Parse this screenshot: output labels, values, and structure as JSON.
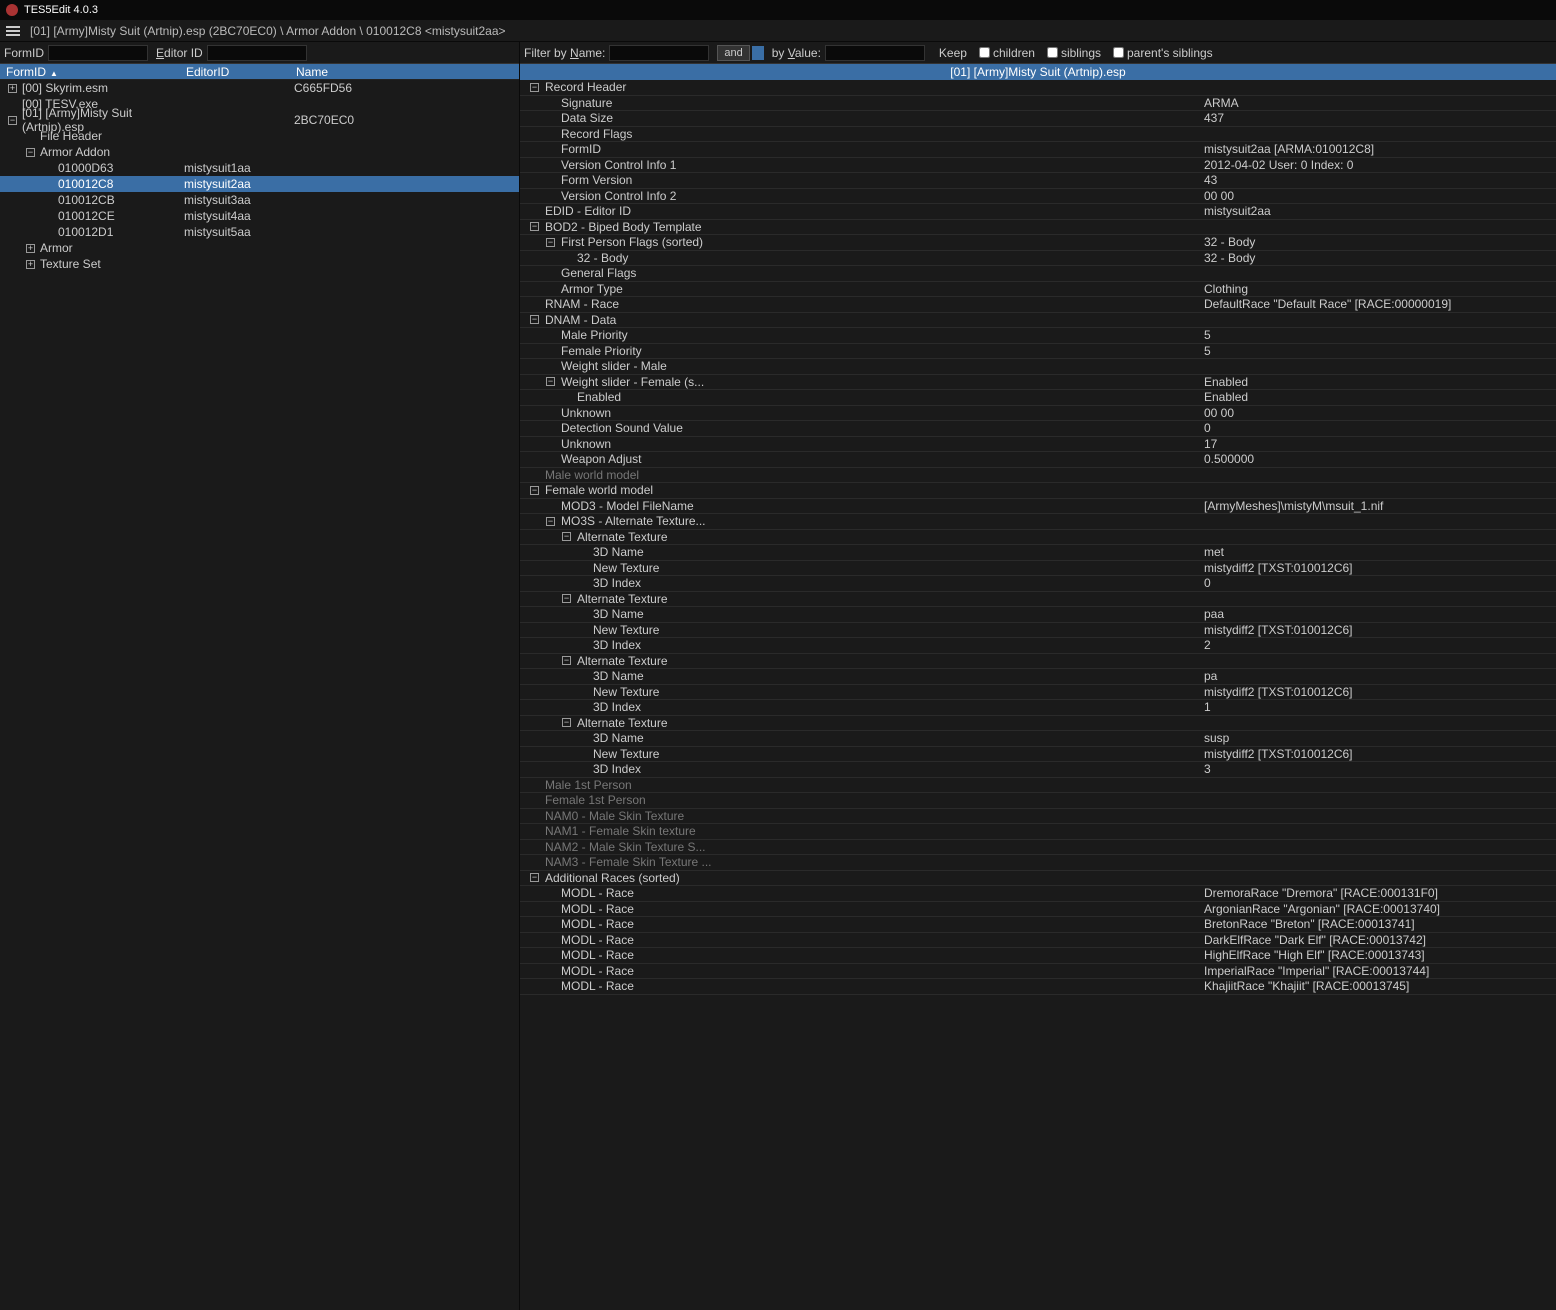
{
  "title": "TES5Edit 4.0.3",
  "breadcrumb": "[01] [Army]Misty Suit (Artnip).esp (2BC70EC0) \\ Armor Addon \\ 010012C8 <mistysuit2aa>",
  "leftFilter": {
    "formId": "FormID",
    "editorId": "Editor ID"
  },
  "leftCols": {
    "id": "FormID",
    "eid": "EditorID",
    "name": "Name"
  },
  "leftTree": [
    {
      "indent": 0,
      "tog": "+",
      "id": "[00] Skyrim.esm",
      "eid": "",
      "name": "C665FD56"
    },
    {
      "indent": 0,
      "tog": "",
      "id": "[00] TESV.exe",
      "eid": "",
      "name": ""
    },
    {
      "indent": 0,
      "tog": "-",
      "id": "[01] [Army]Misty Suit (Artnip).esp",
      "eid": "",
      "name": "2BC70EC0"
    },
    {
      "indent": 1,
      "tog": "",
      "id": "File Header",
      "eid": "",
      "name": ""
    },
    {
      "indent": 1,
      "tog": "-",
      "id": "Armor Addon",
      "eid": "",
      "name": ""
    },
    {
      "indent": 2,
      "tog": "",
      "id": "01000D63",
      "eid": "mistysuit1aa",
      "name": ""
    },
    {
      "indent": 2,
      "tog": "",
      "id": "010012C8",
      "eid": "mistysuit2aa",
      "name": "",
      "sel": true
    },
    {
      "indent": 2,
      "tog": "",
      "id": "010012CB",
      "eid": "mistysuit3aa",
      "name": ""
    },
    {
      "indent": 2,
      "tog": "",
      "id": "010012CE",
      "eid": "mistysuit4aa",
      "name": ""
    },
    {
      "indent": 2,
      "tog": "",
      "id": "010012D1",
      "eid": "mistysuit5aa",
      "name": ""
    },
    {
      "indent": 1,
      "tog": "+",
      "id": "Armor",
      "eid": "",
      "name": ""
    },
    {
      "indent": 1,
      "tog": "+",
      "id": "Texture Set",
      "eid": "",
      "name": ""
    }
  ],
  "rightFilter": {
    "nameLabel": "Filter by Name:",
    "and": "and",
    "valueLabel": "by Value:",
    "keep": "Keep",
    "children": "children",
    "siblings": "siblings",
    "parents": "parent's siblings"
  },
  "rightHeader": "[01] [Army]Misty Suit (Artnip).esp",
  "records": [
    {
      "indent": 0,
      "tog": "-",
      "key": "Record Header",
      "val": ""
    },
    {
      "indent": 1,
      "tog": "",
      "key": "Signature",
      "val": "ARMA"
    },
    {
      "indent": 1,
      "tog": "",
      "key": "Data Size",
      "val": "437"
    },
    {
      "indent": 1,
      "tog": "",
      "key": "Record Flags",
      "val": ""
    },
    {
      "indent": 1,
      "tog": "",
      "key": "FormID",
      "val": "mistysuit2aa [ARMA:010012C8]"
    },
    {
      "indent": 1,
      "tog": "",
      "key": "Version Control Info 1",
      "val": "2012-04-02 User: 0 Index: 0"
    },
    {
      "indent": 1,
      "tog": "",
      "key": "Form Version",
      "val": "43"
    },
    {
      "indent": 1,
      "tog": "",
      "key": "Version Control Info 2",
      "val": "00 00"
    },
    {
      "indent": 0,
      "tog": "",
      "key": "EDID - Editor ID",
      "val": "mistysuit2aa"
    },
    {
      "indent": 0,
      "tog": "-",
      "key": "BOD2 - Biped Body Template",
      "val": ""
    },
    {
      "indent": 1,
      "tog": "-",
      "key": "First Person Flags (sorted)",
      "val": "32 - Body"
    },
    {
      "indent": 2,
      "tog": "",
      "key": "32 - Body",
      "val": "32 - Body"
    },
    {
      "indent": 1,
      "tog": "",
      "key": "General Flags",
      "val": ""
    },
    {
      "indent": 1,
      "tog": "",
      "key": "Armor Type",
      "val": "Clothing"
    },
    {
      "indent": 0,
      "tog": "",
      "key": "RNAM - Race",
      "val": "DefaultRace \"Default Race\" [RACE:00000019]"
    },
    {
      "indent": 0,
      "tog": "-",
      "key": "DNAM - Data",
      "val": ""
    },
    {
      "indent": 1,
      "tog": "",
      "key": "Male Priority",
      "val": "5"
    },
    {
      "indent": 1,
      "tog": "",
      "key": "Female Priority",
      "val": "5"
    },
    {
      "indent": 1,
      "tog": "",
      "key": "Weight slider - Male",
      "val": ""
    },
    {
      "indent": 1,
      "tog": "-",
      "key": "Weight slider - Female (s...",
      "val": "Enabled"
    },
    {
      "indent": 2,
      "tog": "",
      "key": "Enabled",
      "val": "Enabled"
    },
    {
      "indent": 1,
      "tog": "",
      "key": "Unknown",
      "val": "00 00"
    },
    {
      "indent": 1,
      "tog": "",
      "key": "Detection Sound Value",
      "val": "0"
    },
    {
      "indent": 1,
      "tog": "",
      "key": "Unknown",
      "val": "17"
    },
    {
      "indent": 1,
      "tog": "",
      "key": "Weapon Adjust",
      "val": "0.500000"
    },
    {
      "indent": 0,
      "tog": "",
      "key": "Male world model",
      "val": "",
      "dim": true
    },
    {
      "indent": 0,
      "tog": "-",
      "key": "Female world model",
      "val": ""
    },
    {
      "indent": 1,
      "tog": "",
      "key": "MOD3 - Model FileName",
      "val": "[ArmyMeshes]\\mistyM\\msuit_1.nif"
    },
    {
      "indent": 1,
      "tog": "-",
      "key": "MO3S - Alternate Texture...",
      "val": ""
    },
    {
      "indent": 2,
      "tog": "-",
      "key": "Alternate Texture",
      "val": ""
    },
    {
      "indent": 3,
      "tog": "",
      "key": "3D Name",
      "val": "met"
    },
    {
      "indent": 3,
      "tog": "",
      "key": "New Texture",
      "val": "mistydiff2 [TXST:010012C6]"
    },
    {
      "indent": 3,
      "tog": "",
      "key": "3D Index",
      "val": "0"
    },
    {
      "indent": 2,
      "tog": "-",
      "key": "Alternate Texture",
      "val": ""
    },
    {
      "indent": 3,
      "tog": "",
      "key": "3D Name",
      "val": "paa"
    },
    {
      "indent": 3,
      "tog": "",
      "key": "New Texture",
      "val": "mistydiff2 [TXST:010012C6]"
    },
    {
      "indent": 3,
      "tog": "",
      "key": "3D Index",
      "val": "2"
    },
    {
      "indent": 2,
      "tog": "-",
      "key": "Alternate Texture",
      "val": ""
    },
    {
      "indent": 3,
      "tog": "",
      "key": "3D Name",
      "val": "pa"
    },
    {
      "indent": 3,
      "tog": "",
      "key": "New Texture",
      "val": "mistydiff2 [TXST:010012C6]"
    },
    {
      "indent": 3,
      "tog": "",
      "key": "3D Index",
      "val": "1"
    },
    {
      "indent": 2,
      "tog": "-",
      "key": "Alternate Texture",
      "val": ""
    },
    {
      "indent": 3,
      "tog": "",
      "key": "3D Name",
      "val": "susp"
    },
    {
      "indent": 3,
      "tog": "",
      "key": "New Texture",
      "val": "mistydiff2 [TXST:010012C6]"
    },
    {
      "indent": 3,
      "tog": "",
      "key": "3D Index",
      "val": "3"
    },
    {
      "indent": 0,
      "tog": "",
      "key": "Male 1st Person",
      "val": "",
      "dim": true
    },
    {
      "indent": 0,
      "tog": "",
      "key": "Female 1st Person",
      "val": "",
      "dim": true
    },
    {
      "indent": 0,
      "tog": "",
      "key": "NAM0 - Male Skin Texture",
      "val": "",
      "dim": true
    },
    {
      "indent": 0,
      "tog": "",
      "key": "NAM1 - Female Skin texture",
      "val": "",
      "dim": true
    },
    {
      "indent": 0,
      "tog": "",
      "key": "NAM2 - Male Skin Texture S...",
      "val": "",
      "dim": true
    },
    {
      "indent": 0,
      "tog": "",
      "key": "NAM3 - Female Skin Texture ...",
      "val": "",
      "dim": true
    },
    {
      "indent": 0,
      "tog": "-",
      "key": "Additional Races (sorted)",
      "val": ""
    },
    {
      "indent": 1,
      "tog": "",
      "key": "MODL - Race",
      "val": "DremoraRace \"Dremora\" [RACE:000131F0]"
    },
    {
      "indent": 1,
      "tog": "",
      "key": "MODL - Race",
      "val": "ArgonianRace \"Argonian\" [RACE:00013740]"
    },
    {
      "indent": 1,
      "tog": "",
      "key": "MODL - Race",
      "val": "BretonRace \"Breton\" [RACE:00013741]"
    },
    {
      "indent": 1,
      "tog": "",
      "key": "MODL - Race",
      "val": "DarkElfRace \"Dark Elf\" [RACE:00013742]"
    },
    {
      "indent": 1,
      "tog": "",
      "key": "MODL - Race",
      "val": "HighElfRace \"High Elf\" [RACE:00013743]"
    },
    {
      "indent": 1,
      "tog": "",
      "key": "MODL - Race",
      "val": "ImperialRace \"Imperial\" [RACE:00013744]"
    },
    {
      "indent": 1,
      "tog": "",
      "key": "MODL - Race",
      "val": "KhajiitRace \"Khajiit\" [RACE:00013745]"
    }
  ]
}
